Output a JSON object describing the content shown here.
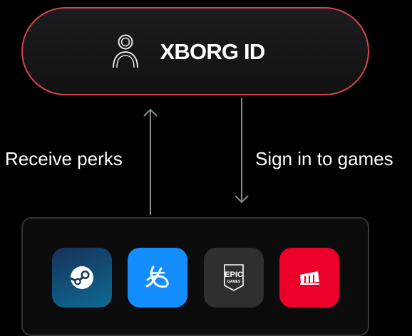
{
  "id_node": {
    "title": "XBORG ID",
    "icon": "user-outline-icon",
    "border_color": "#d8434e"
  },
  "connections": {
    "left_label": "Receive perks",
    "left_direction": "up",
    "right_label": "Sign in to games",
    "right_direction": "down"
  },
  "games": [
    {
      "name": "Steam",
      "icon": "steam-icon",
      "color": "#0d6a93"
    },
    {
      "name": "Battle.net",
      "icon": "battlenet-icon",
      "color": "#148eff"
    },
    {
      "name": "Epic Games",
      "icon": "epic-games-icon",
      "color": "#2f2f2f",
      "logo_text_top": "EPIC",
      "logo_text_bottom": "GAMES"
    },
    {
      "name": "Riot Games",
      "icon": "riot-games-icon",
      "color": "#eb0029"
    }
  ]
}
